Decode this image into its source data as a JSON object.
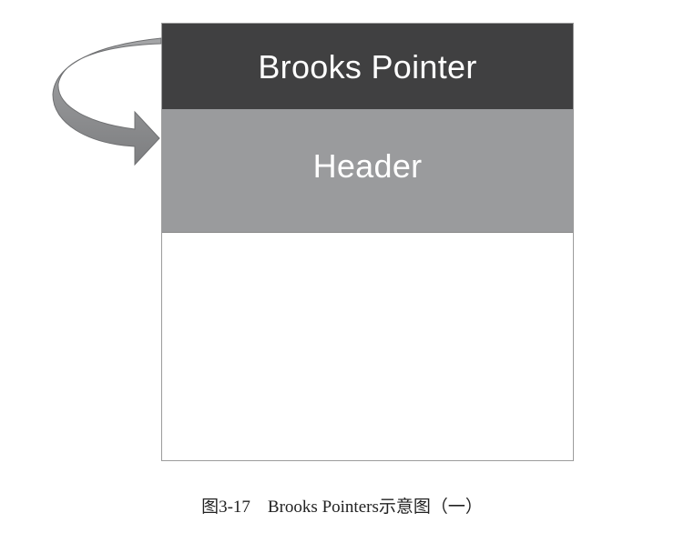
{
  "diagram": {
    "brooks_pointer_label": "Brooks Pointer",
    "header_label": "Header",
    "caption": "图3-17    Brooks Pointers示意图（一）"
  },
  "colors": {
    "brooks_pointer_fill": "#404041",
    "header_fill": "#9a9b9d",
    "body_fill": "#ffffff",
    "arrow_fill": "#8c8d8f",
    "arrow_stroke": "#6f7072"
  },
  "icons": {
    "arrow": "curved-self-pointer-arrow-icon"
  }
}
